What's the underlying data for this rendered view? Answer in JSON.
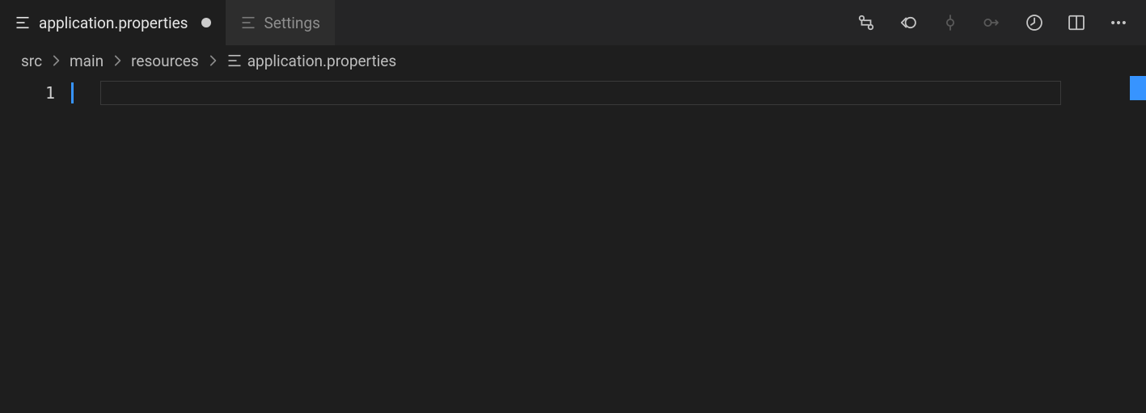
{
  "tabs": [
    {
      "label": "application.properties",
      "icon": "file-lines-icon",
      "active": true,
      "dirty": true
    },
    {
      "label": "Settings",
      "icon": "file-lines-icon",
      "active": false,
      "dirty": false
    }
  ],
  "toolbar": {
    "actions": [
      {
        "name": "compare-changes-icon",
        "dim": false
      },
      {
        "name": "revert-icon",
        "dim": false
      },
      {
        "name": "commit-icon",
        "dim": true
      },
      {
        "name": "push-icon",
        "dim": true
      },
      {
        "name": "timeline-icon",
        "dim": false
      },
      {
        "name": "split-editor-icon",
        "dim": false
      },
      {
        "name": "more-icon",
        "dim": false
      }
    ]
  },
  "breadcrumb": {
    "segments": [
      "src",
      "main",
      "resources"
    ],
    "file": {
      "label": "application.properties",
      "icon": "file-lines-icon"
    }
  },
  "editor": {
    "line_numbers": [
      "1"
    ],
    "content": ""
  }
}
